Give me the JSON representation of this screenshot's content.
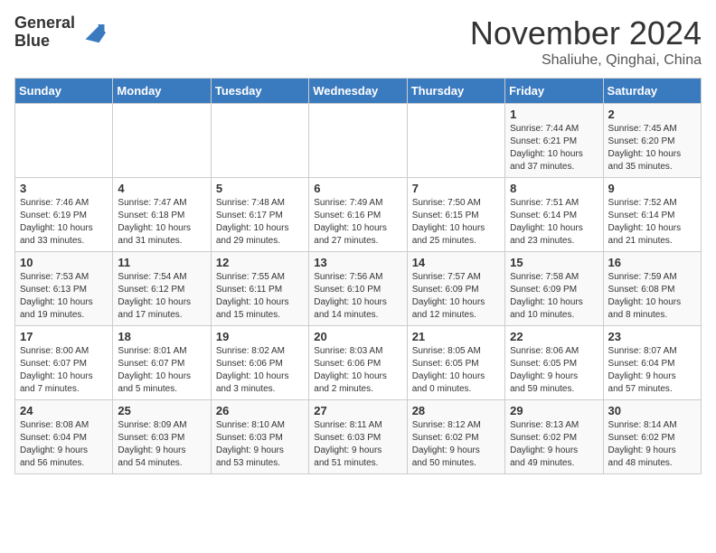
{
  "header": {
    "logo_line1": "General",
    "logo_line2": "Blue",
    "month": "November 2024",
    "location": "Shaliuhe, Qinghai, China"
  },
  "days_of_week": [
    "Sunday",
    "Monday",
    "Tuesday",
    "Wednesday",
    "Thursday",
    "Friday",
    "Saturday"
  ],
  "weeks": [
    [
      {
        "day": "",
        "info": ""
      },
      {
        "day": "",
        "info": ""
      },
      {
        "day": "",
        "info": ""
      },
      {
        "day": "",
        "info": ""
      },
      {
        "day": "",
        "info": ""
      },
      {
        "day": "1",
        "info": "Sunrise: 7:44 AM\nSunset: 6:21 PM\nDaylight: 10 hours\nand 37 minutes."
      },
      {
        "day": "2",
        "info": "Sunrise: 7:45 AM\nSunset: 6:20 PM\nDaylight: 10 hours\nand 35 minutes."
      }
    ],
    [
      {
        "day": "3",
        "info": "Sunrise: 7:46 AM\nSunset: 6:19 PM\nDaylight: 10 hours\nand 33 minutes."
      },
      {
        "day": "4",
        "info": "Sunrise: 7:47 AM\nSunset: 6:18 PM\nDaylight: 10 hours\nand 31 minutes."
      },
      {
        "day": "5",
        "info": "Sunrise: 7:48 AM\nSunset: 6:17 PM\nDaylight: 10 hours\nand 29 minutes."
      },
      {
        "day": "6",
        "info": "Sunrise: 7:49 AM\nSunset: 6:16 PM\nDaylight: 10 hours\nand 27 minutes."
      },
      {
        "day": "7",
        "info": "Sunrise: 7:50 AM\nSunset: 6:15 PM\nDaylight: 10 hours\nand 25 minutes."
      },
      {
        "day": "8",
        "info": "Sunrise: 7:51 AM\nSunset: 6:14 PM\nDaylight: 10 hours\nand 23 minutes."
      },
      {
        "day": "9",
        "info": "Sunrise: 7:52 AM\nSunset: 6:14 PM\nDaylight: 10 hours\nand 21 minutes."
      }
    ],
    [
      {
        "day": "10",
        "info": "Sunrise: 7:53 AM\nSunset: 6:13 PM\nDaylight: 10 hours\nand 19 minutes."
      },
      {
        "day": "11",
        "info": "Sunrise: 7:54 AM\nSunset: 6:12 PM\nDaylight: 10 hours\nand 17 minutes."
      },
      {
        "day": "12",
        "info": "Sunrise: 7:55 AM\nSunset: 6:11 PM\nDaylight: 10 hours\nand 15 minutes."
      },
      {
        "day": "13",
        "info": "Sunrise: 7:56 AM\nSunset: 6:10 PM\nDaylight: 10 hours\nand 14 minutes."
      },
      {
        "day": "14",
        "info": "Sunrise: 7:57 AM\nSunset: 6:09 PM\nDaylight: 10 hours\nand 12 minutes."
      },
      {
        "day": "15",
        "info": "Sunrise: 7:58 AM\nSunset: 6:09 PM\nDaylight: 10 hours\nand 10 minutes."
      },
      {
        "day": "16",
        "info": "Sunrise: 7:59 AM\nSunset: 6:08 PM\nDaylight: 10 hours\nand 8 minutes."
      }
    ],
    [
      {
        "day": "17",
        "info": "Sunrise: 8:00 AM\nSunset: 6:07 PM\nDaylight: 10 hours\nand 7 minutes."
      },
      {
        "day": "18",
        "info": "Sunrise: 8:01 AM\nSunset: 6:07 PM\nDaylight: 10 hours\nand 5 minutes."
      },
      {
        "day": "19",
        "info": "Sunrise: 8:02 AM\nSunset: 6:06 PM\nDaylight: 10 hours\nand 3 minutes."
      },
      {
        "day": "20",
        "info": "Sunrise: 8:03 AM\nSunset: 6:06 PM\nDaylight: 10 hours\nand 2 minutes."
      },
      {
        "day": "21",
        "info": "Sunrise: 8:05 AM\nSunset: 6:05 PM\nDaylight: 10 hours\nand 0 minutes."
      },
      {
        "day": "22",
        "info": "Sunrise: 8:06 AM\nSunset: 6:05 PM\nDaylight: 9 hours\nand 59 minutes."
      },
      {
        "day": "23",
        "info": "Sunrise: 8:07 AM\nSunset: 6:04 PM\nDaylight: 9 hours\nand 57 minutes."
      }
    ],
    [
      {
        "day": "24",
        "info": "Sunrise: 8:08 AM\nSunset: 6:04 PM\nDaylight: 9 hours\nand 56 minutes."
      },
      {
        "day": "25",
        "info": "Sunrise: 8:09 AM\nSunset: 6:03 PM\nDaylight: 9 hours\nand 54 minutes."
      },
      {
        "day": "26",
        "info": "Sunrise: 8:10 AM\nSunset: 6:03 PM\nDaylight: 9 hours\nand 53 minutes."
      },
      {
        "day": "27",
        "info": "Sunrise: 8:11 AM\nSunset: 6:03 PM\nDaylight: 9 hours\nand 51 minutes."
      },
      {
        "day": "28",
        "info": "Sunrise: 8:12 AM\nSunset: 6:02 PM\nDaylight: 9 hours\nand 50 minutes."
      },
      {
        "day": "29",
        "info": "Sunrise: 8:13 AM\nSunset: 6:02 PM\nDaylight: 9 hours\nand 49 minutes."
      },
      {
        "day": "30",
        "info": "Sunrise: 8:14 AM\nSunset: 6:02 PM\nDaylight: 9 hours\nand 48 minutes."
      }
    ]
  ]
}
